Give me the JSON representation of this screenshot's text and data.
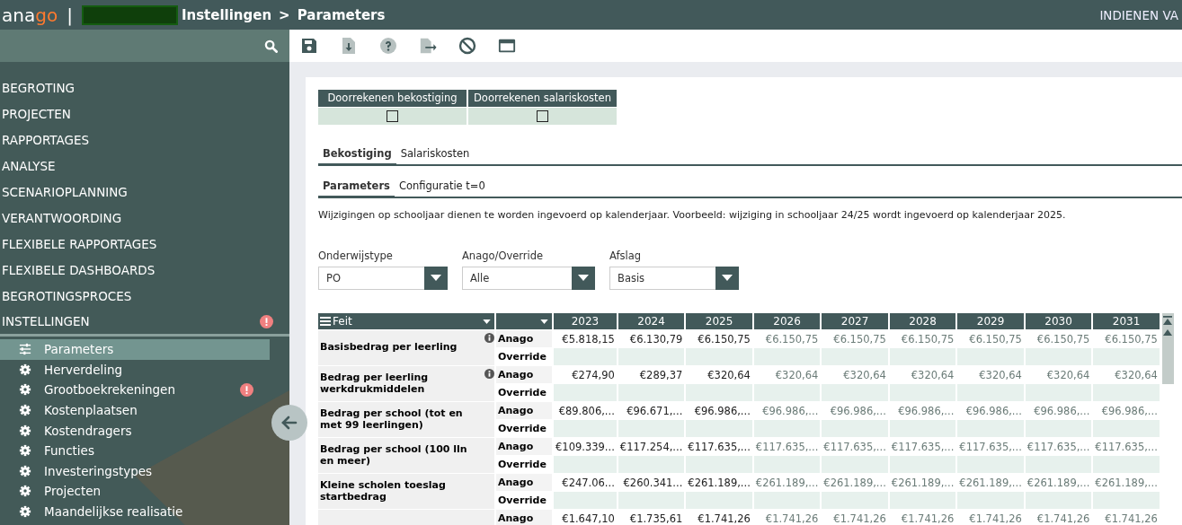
{
  "header": {
    "logo_main": "ana",
    "logo_accent": "go",
    "separator": "|",
    "breadcrumb": [
      "Instellingen",
      "Parameters"
    ],
    "breadcrumb_separator": ">",
    "right_link": "INDIENEN VA"
  },
  "sidebar": {
    "menu": [
      {
        "label": "BEGROTING",
        "alert": false
      },
      {
        "label": "PROJECTEN",
        "alert": false
      },
      {
        "label": "RAPPORTAGES",
        "alert": false
      },
      {
        "label": "ANALYSE",
        "alert": false
      },
      {
        "label": "SCENARIOPLANNING",
        "alert": false
      },
      {
        "label": "VERANTWOORDING",
        "alert": false
      },
      {
        "label": "FLEXIBELE RAPPORTAGES",
        "alert": false
      },
      {
        "label": "FLEXIBELE DASHBOARDS",
        "alert": false
      },
      {
        "label": "BEGROTINGSPROCES",
        "alert": false
      },
      {
        "label": "INSTELLINGEN",
        "alert": true,
        "expanded": true,
        "children": [
          {
            "label": "Parameters",
            "kind": "sliders",
            "selected": true,
            "alert": false
          },
          {
            "label": "Herverdeling",
            "kind": "gear",
            "selected": false,
            "alert": false
          },
          {
            "label": "Grootboekrekeningen",
            "kind": "gear",
            "selected": false,
            "alert": true
          },
          {
            "label": "Kostenplaatsen",
            "kind": "gear",
            "selected": false,
            "alert": false
          },
          {
            "label": "Kostendragers",
            "kind": "gear",
            "selected": false,
            "alert": false
          },
          {
            "label": "Functies",
            "kind": "gear",
            "selected": false,
            "alert": false
          },
          {
            "label": "Investeringstypes",
            "kind": "gear",
            "selected": false,
            "alert": false
          },
          {
            "label": "Projecten",
            "kind": "gear",
            "selected": false,
            "alert": false
          },
          {
            "label": "Maandelijkse realisatie",
            "kind": "gear",
            "selected": false,
            "alert": false
          }
        ]
      }
    ]
  },
  "toolbar": [
    {
      "kind": "save",
      "disabled": false
    },
    {
      "kind": "download",
      "disabled": true
    },
    {
      "kind": "help",
      "disabled": true
    },
    {
      "kind": "export",
      "disabled": true
    },
    {
      "kind": "ban",
      "disabled": false
    },
    {
      "kind": "window",
      "disabled": false
    }
  ],
  "calc_table": [
    {
      "label": "Doorrekenen bekostiging",
      "checked": false
    },
    {
      "label": "Doorrekenen salariskosten",
      "checked": false
    }
  ],
  "tabs": [
    {
      "label": "Bekostiging",
      "selected": true
    },
    {
      "label": "Salariskosten",
      "selected": false
    }
  ],
  "subtabs": [
    {
      "label": "Parameters",
      "selected": true
    },
    {
      "label": "Configuratie t=0",
      "selected": false
    }
  ],
  "notice": "Wijzigingen op schooljaar dienen te worden ingevoerd op kalenderjaar. Voorbeeld: wijziging in schooljaar 24/25 wordt ingevoerd op kalenderjaar 2025.",
  "filters": [
    {
      "label": "Onderwijstype",
      "value": "PO"
    },
    {
      "label": "Anago/Override",
      "value": "Alle"
    },
    {
      "label": "Afslag",
      "value": "Basis"
    }
  ],
  "grid": {
    "feit_header": "Feit",
    "columns": [
      {
        "label": "2023",
        "estimated": false
      },
      {
        "label": "2024",
        "estimated": false
      },
      {
        "label": "2025",
        "estimated": false
      },
      {
        "label": "2026",
        "estimated": true
      },
      {
        "label": "2027",
        "estimated": true
      },
      {
        "label": "2028",
        "estimated": true
      },
      {
        "label": "2029",
        "estimated": true
      },
      {
        "label": "2030",
        "estimated": true
      },
      {
        "label": "2031",
        "estimated": true
      }
    ],
    "rows": [
      {
        "label": "Basisbedrag per leerling",
        "info": true,
        "lines": [
          {
            "type": "Anago",
            "values": [
              "€5.818,15",
              "€6.130,79",
              "€6.150,75",
              "€6.150,75",
              "€6.150,75",
              "€6.150,75",
              "€6.150,75",
              "€6.150,75",
              "€6.150,75"
            ]
          },
          {
            "type": "Override"
          }
        ]
      },
      {
        "label": "Bedrag per leerling werkdrukmiddelen",
        "info": true,
        "lines": [
          {
            "type": "Anago",
            "values": [
              "€274,90",
              "€289,37",
              "€320,64",
              "€320,64",
              "€320,64",
              "€320,64",
              "€320,64",
              "€320,64",
              "€320,64"
            ]
          },
          {
            "type": "Override"
          }
        ]
      },
      {
        "label": "Bedrag per school (tot en met 99 leerlingen)",
        "info": false,
        "lines": [
          {
            "type": "Anago",
            "values": [
              "€89.806,...",
              "€96.671,...",
              "€96.986,...",
              "€96.986,...",
              "€96.986,...",
              "€96.986,...",
              "€96.986,...",
              "€96.986,...",
              "€96.986,..."
            ]
          },
          {
            "type": "Override"
          }
        ]
      },
      {
        "label": "Bedrag per school (100 lln en meer)",
        "info": false,
        "lines": [
          {
            "type": "Anago",
            "values": [
              "€109.339...",
              "€117.254,...",
              "€117.635,...",
              "€117.635,...",
              "€117.635,...",
              "€117.635,...",
              "€117.635,...",
              "€117.635,...",
              "€117.635,..."
            ]
          },
          {
            "type": "Override"
          }
        ]
      },
      {
        "label": "Kleine scholen toeslag startbedrag",
        "info": false,
        "lines": [
          {
            "type": "Anago",
            "values": [
              "€247.06...",
              "€260.341...",
              "€261.189,...",
              "€261.189,...",
              "€261.189,...",
              "€261.189,...",
              "€261.189,...",
              "€261.189,...",
              "€261.189,..."
            ]
          },
          {
            "type": "Override"
          }
        ]
      },
      {
        "info": false,
        "lines": [
          {
            "type": "Anago",
            "values": [
              "€1.647,10",
              "€1.735,61",
              "€1.741,26",
              "€1.741,26",
              "€1.741,26",
              "€1.741,26",
              "€1.741,26",
              "€1.741,26",
              "€1.741,26"
            ]
          }
        ]
      }
    ]
  }
}
